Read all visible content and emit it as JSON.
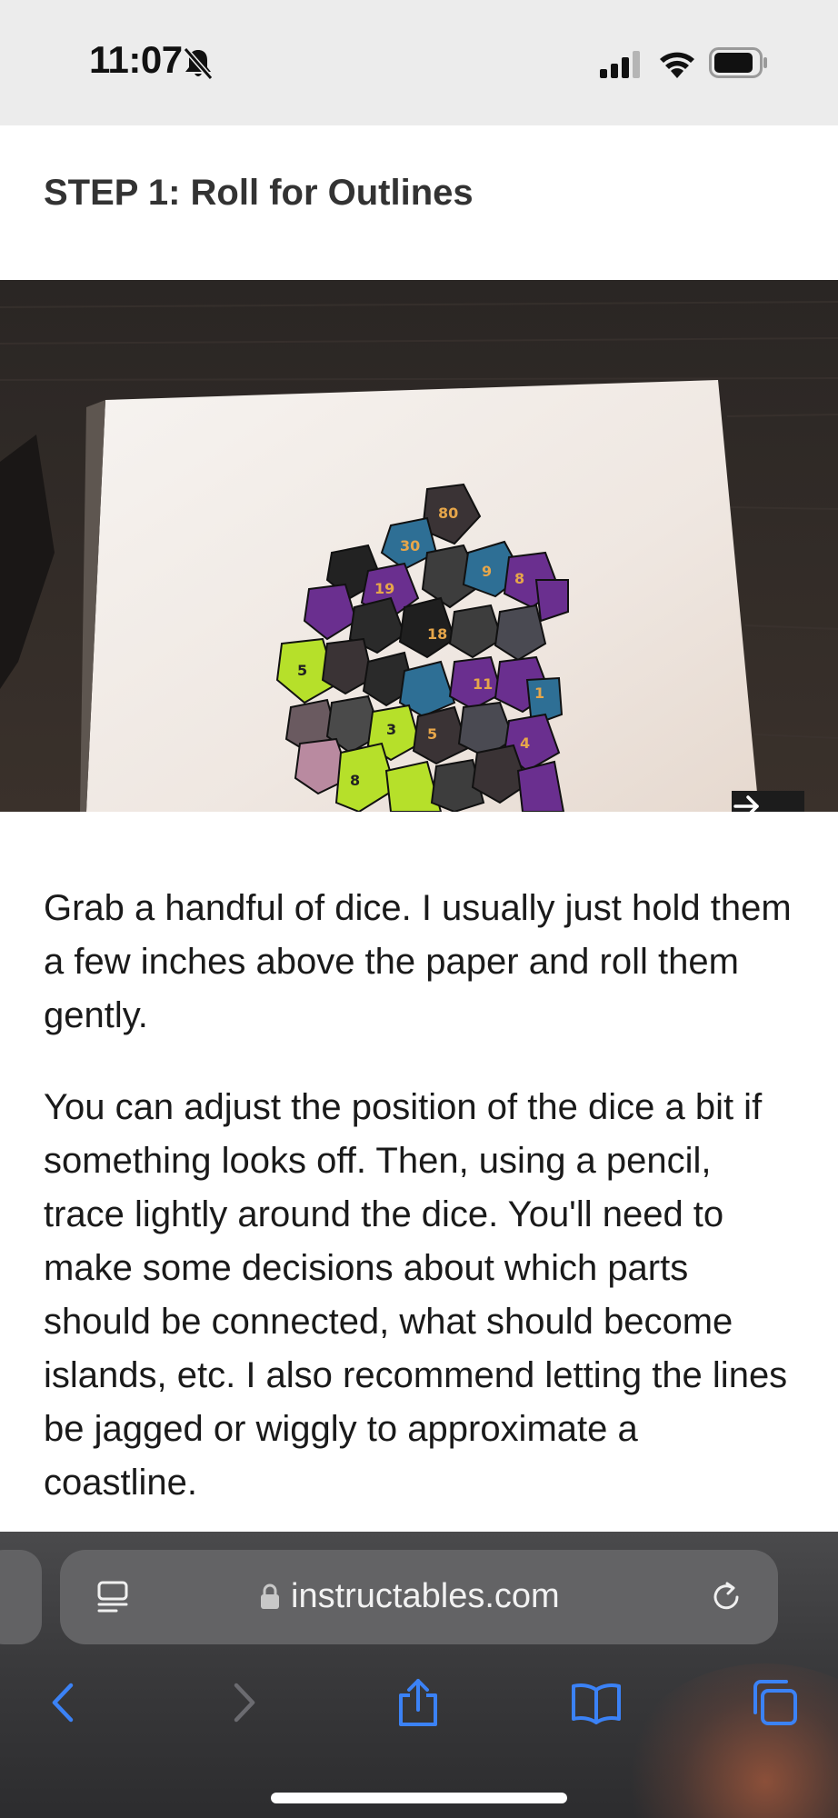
{
  "status_bar": {
    "time": "11:07",
    "bell_icon": "bell-slash-icon",
    "signal_icon": "cellular-signal-icon",
    "wifi_icon": "wifi-icon",
    "battery_icon": "battery-icon"
  },
  "article": {
    "step_title": "STEP 1: Roll for Outlines",
    "photo_next_icon": "arrow-right-icon",
    "paragraphs": [
      "Grab a handful of dice. I usually just hold them a few inches above the paper and roll them gently.",
      "You can adjust the position of the dice a bit if something looks off. Then, using a pencil, trace lightly around the dice. You'll need to make some decisions about which parts should be connected, what should become islands, etc. I also recommend letting the lines be jagged or wiggly to approximate a coastline."
    ]
  },
  "browser": {
    "url": "instructables.com",
    "reader_icon": "reader-mode-icon",
    "lock_icon": "lock-icon",
    "reload_icon": "reload-icon",
    "toolbar": {
      "back_icon": "chevron-left-icon",
      "forward_icon": "chevron-right-icon",
      "share_icon": "share-icon",
      "bookmarks_icon": "book-icon",
      "tabs_icon": "tabs-icon"
    },
    "accent_color": "#3b82f6"
  }
}
